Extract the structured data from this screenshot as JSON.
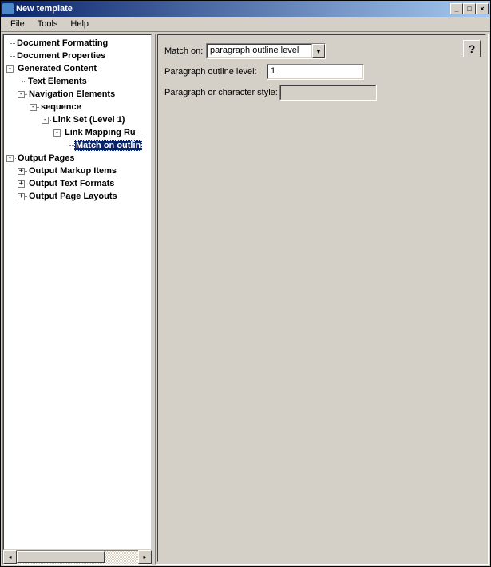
{
  "title": "New template",
  "menu": {
    "file": "File",
    "tools": "Tools",
    "help": "Help"
  },
  "tree": {
    "n0": "Document Formatting",
    "n1": "Document Properties",
    "n2": "Generated Content",
    "n3": "Text Elements",
    "n4": "Navigation Elements",
    "n5": "sequence",
    "n6": "Link Set (Level 1)",
    "n7": "Link Mapping Ru",
    "n8": "Match on outlin",
    "n9": "Output Pages",
    "n10": "Output Markup Items",
    "n11": "Output Text Formats",
    "n12": "Output Page Layouts"
  },
  "form": {
    "match_on_label": "Match on:",
    "match_on_value": "paragraph outline level",
    "pol_label": "Paragraph outline level:",
    "pol_value": "1",
    "pcs_label": "Paragraph or character style:",
    "pcs_value": ""
  },
  "help_label": "?"
}
